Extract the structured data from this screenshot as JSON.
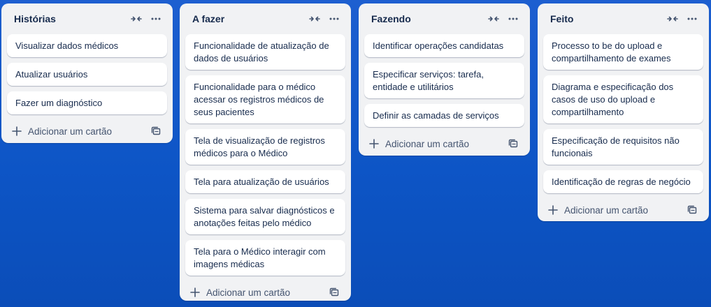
{
  "colors": {
    "background": "#0d55c6",
    "list_bg": "#f1f2f4",
    "card_bg": "#ffffff",
    "text": "#172b4d",
    "muted": "#44546f"
  },
  "icons": {
    "collapse": "collapse-arrows-icon",
    "more": "more-horizontal-icon",
    "add": "plus-icon",
    "template": "card-template-icon"
  },
  "add_card_label": "Adicionar um cartão",
  "lists": [
    {
      "title": "Histórias",
      "cards": [
        "Visualizar dados médicos",
        "Atualizar usuários",
        "Fazer um diagnóstico"
      ]
    },
    {
      "title": "A fazer",
      "cards": [
        "Funcionalidade de atualização de dados de usuários",
        "Funcionalidade para o médico acessar os registros médicos de seus pacientes",
        "Tela de visualização de registros médicos para o Médico",
        "Tela para atualização de usuários",
        "Sistema para salvar diagnósticos e anotações feitas pelo médico",
        "Tela para o Médico interagir com imagens médicas"
      ]
    },
    {
      "title": "Fazendo",
      "cards": [
        "Identificar operações candidatas",
        "Especificar serviços: tarefa, entidade e utilitários",
        "Definir as camadas de serviços"
      ]
    },
    {
      "title": "Feito",
      "cards": [
        "Processo to be do upload e compartilhamento de exames",
        "Diagrama e especificação dos casos de uso do upload e compartilhamento",
        "Especificação de requisitos não funcionais",
        "Identificação de regras de negócio"
      ]
    }
  ]
}
